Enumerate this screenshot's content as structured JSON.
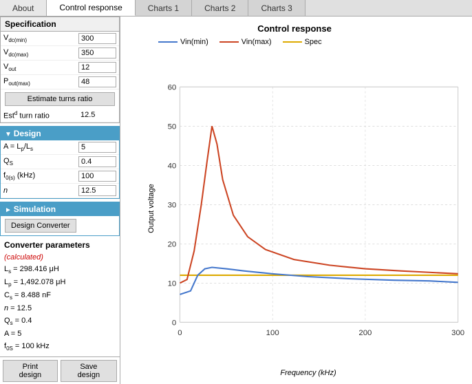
{
  "tabs": [
    {
      "id": "about",
      "label": "About",
      "active": false
    },
    {
      "id": "control-response",
      "label": "Control response",
      "active": true
    },
    {
      "id": "charts1",
      "label": "Charts 1",
      "active": false
    },
    {
      "id": "charts2",
      "label": "Charts 2",
      "active": false
    },
    {
      "id": "charts3",
      "label": "Charts 3",
      "active": false
    }
  ],
  "specification": {
    "title": "Specification",
    "params": [
      {
        "label_html": "V<sub>dc(min)</sub>",
        "label": "Vdc(min)",
        "value": "300"
      },
      {
        "label_html": "V<sub>dc(max)</sub>",
        "label": "Vdc(max)",
        "value": "350"
      },
      {
        "label_html": "V<sub>out</sub>",
        "label": "Vout",
        "value": "12"
      },
      {
        "label_html": "P<sub>out(max)</sub>",
        "label": "Pout(max)",
        "value": "48"
      }
    ],
    "estimate_btn": "Estimate turns ratio",
    "est_label": "Estᴯ turn ratio",
    "est_value": "12.5"
  },
  "design": {
    "title": "Design",
    "params": [
      {
        "label_html": "A = L<sub>p</sub>/L<sub>s</sub>",
        "label": "A",
        "value": "5"
      },
      {
        "label_html": "Q<sub>S</sub>",
        "label": "Qs",
        "value": "0.4"
      },
      {
        "label_html": "f<sub>0(s)</sub> (kHz)",
        "label": "f0s (kHz)",
        "value": "100"
      },
      {
        "label_html": "n",
        "label": "n",
        "value": "12.5"
      }
    ]
  },
  "simulation": {
    "title": "Simulation",
    "design_btn": "Design Converter"
  },
  "converter_params": {
    "title": "Converter parameters",
    "calc_label": "(calculated)",
    "lines": [
      "Ls = 298.416 μH",
      "Lp = 1,492.078 μH",
      "Cs = 8.488 nF",
      "n = 12.5",
      "Qs = 0.4",
      "A = 5",
      "f0S = 100 kHz"
    ]
  },
  "bottom_buttons": {
    "print": "Print design",
    "save": "Save design"
  },
  "chart": {
    "title": "Control response",
    "y_label": "Output voltage",
    "x_label": "Frequency (kHz)",
    "legend": [
      {
        "label": "Vin(min)",
        "color": "#4477cc"
      },
      {
        "label": "Vin(max)",
        "color": "#cc4422"
      },
      {
        "label": "Spec",
        "color": "#ddaa00"
      }
    ],
    "y_axis": {
      "min": 0,
      "max": 60,
      "ticks": [
        0,
        10,
        20,
        30,
        40,
        50,
        60
      ]
    },
    "x_axis": {
      "min": 0,
      "max": 300,
      "ticks": [
        0,
        100,
        200,
        300
      ]
    }
  }
}
